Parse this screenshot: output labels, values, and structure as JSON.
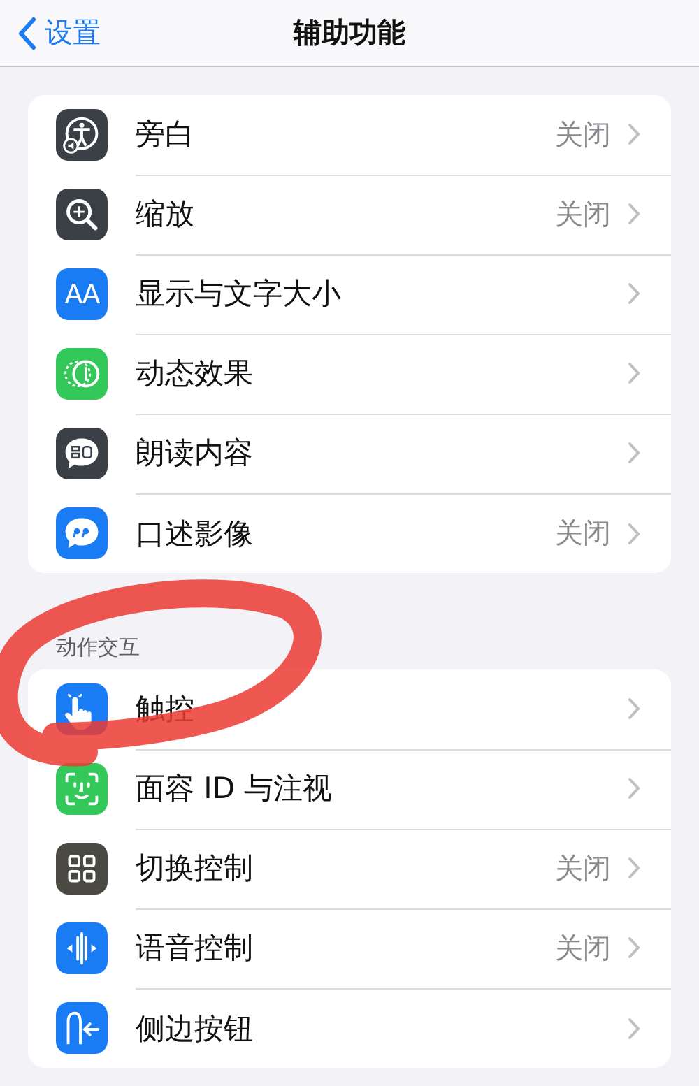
{
  "nav": {
    "back": "设置",
    "title": "辅助功能"
  },
  "groups": [
    {
      "rows": [
        {
          "kind": "voiceover",
          "label": "旁白",
          "value": "关闭"
        },
        {
          "kind": "zoom",
          "label": "缩放",
          "value": "关闭"
        },
        {
          "kind": "text-size",
          "icon_text": "AA",
          "label": "显示与文字大小"
        },
        {
          "kind": "motion",
          "label": "动态效果"
        },
        {
          "kind": "spoken",
          "label": "朗读内容"
        },
        {
          "kind": "audio-description",
          "label": "口述影像",
          "value": "关闭"
        }
      ]
    },
    {
      "header": "动作交互",
      "rows": [
        {
          "kind": "touch",
          "label": "触控"
        },
        {
          "kind": "face-id",
          "label": "面容 ID 与注视"
        },
        {
          "kind": "switch",
          "label": "切换控制",
          "value": "关闭"
        },
        {
          "kind": "voice",
          "label": "语音控制",
          "value": "关闭"
        },
        {
          "kind": "side-button",
          "label": "侧边按钮"
        }
      ]
    }
  ]
}
